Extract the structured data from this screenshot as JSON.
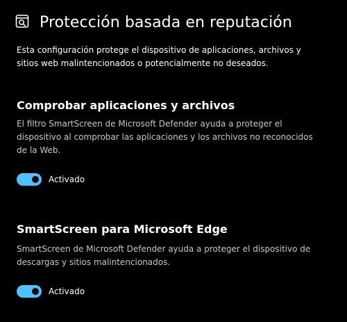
{
  "header": {
    "title": "Protección basada en reputación",
    "icon": "reputation-shield-search-icon"
  },
  "intro": {
    "text": "Esta configuración protege el dispositivo de aplicaciones, archivos y sitios web malintencionados o potencialmente no deseados."
  },
  "sections": [
    {
      "title": "Comprobar aplicaciones y archivos",
      "description": "El filtro SmartScreen de Microsoft Defender ayuda a proteger el dispositivo al comprobar las aplicaciones y los archivos no reconocidos de la Web.",
      "toggle": {
        "state": "on",
        "label": "Activado"
      }
    },
    {
      "title": "SmartScreen para Microsoft Edge",
      "description": "SmartScreen de Microsoft Defender ayuda a proteger el dispositivo de descargas y sitios malintencionados.",
      "toggle": {
        "state": "on",
        "label": "Activado"
      }
    }
  ],
  "colors": {
    "background": "#000000",
    "accent": "#4cc2ff",
    "text": "#ffffff",
    "secondary_text": "#c8c8c8"
  }
}
